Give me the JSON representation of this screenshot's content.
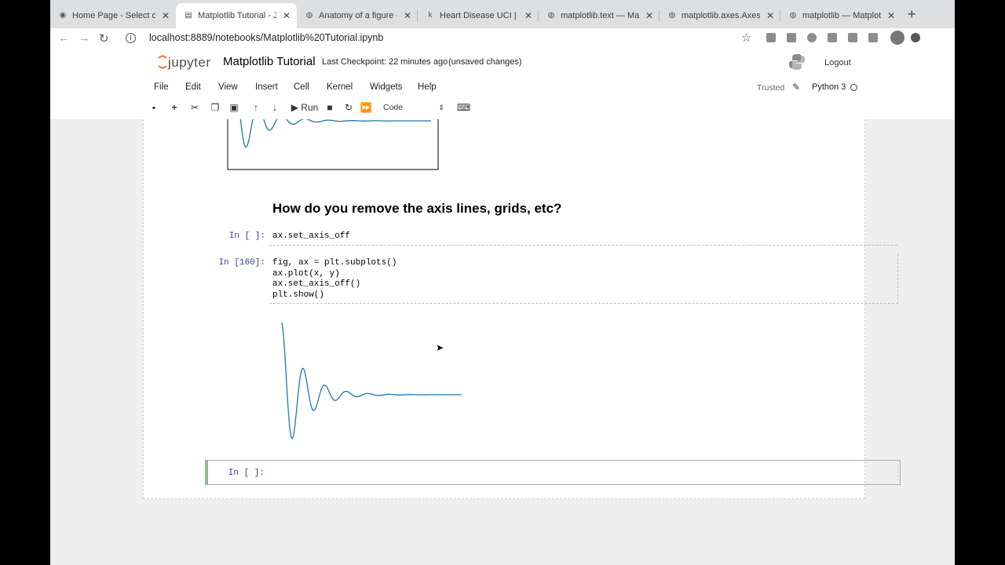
{
  "browser": {
    "tabs": [
      {
        "title": "Home Page - Select o",
        "icon": "jupyter-icon"
      },
      {
        "title": "Matplotlib Tutorial - J",
        "icon": "notebook-icon"
      },
      {
        "title": "Anatomy of a figure —",
        "icon": "matplotlib-icon"
      },
      {
        "title": "Heart Disease UCI | K",
        "icon": "kaggle-icon"
      },
      {
        "title": "matplotlib.text — Ma",
        "icon": "matplotlib-icon"
      },
      {
        "title": "matplotlib.axes.Axes.",
        "icon": "matplotlib-icon"
      },
      {
        "title": "matplotlib — Matplot",
        "icon": "matplotlib-icon"
      }
    ],
    "url": "localhost:8889/notebooks/Matplotlib%20Tutorial.ipynb",
    "new_tab": "+"
  },
  "jupyter": {
    "logo_text": "jupyter",
    "title": "Matplotlib Tutorial",
    "checkpoint": "Last Checkpoint: 22 minutes ago",
    "unsaved": "(unsaved changes)",
    "logout": "Logout",
    "menu": [
      "File",
      "Edit",
      "View",
      "Insert",
      "Cell",
      "Kernel",
      "Widgets",
      "Help"
    ],
    "trusted": "Trusted",
    "kernel": "Python 3",
    "run_label": "Run",
    "cell_type": "Code"
  },
  "notebook": {
    "heading": "How do you remove the axis lines, grids, etc?",
    "cells": [
      {
        "prompt": "In [ ]:",
        "code": [
          "ax.set_axis_off"
        ]
      },
      {
        "prompt": "In [160]:",
        "code": [
          "fig, ax = plt.subplots()",
          "ax.plot(x, y)",
          "ax.set_axis_off()",
          "plt.show()"
        ]
      },
      {
        "prompt": "In [ ]:",
        "code": []
      }
    ]
  },
  "chart_data": [
    {
      "type": "line",
      "title": "",
      "xlabel": "",
      "ylabel": "",
      "axis_visible": true,
      "note": "previous cell output (clipped at top)",
      "function": "damped oscillation"
    },
    {
      "type": "line",
      "title": "",
      "xlabel": "",
      "ylabel": "",
      "axis_visible": false,
      "grid": false,
      "series": [
        {
          "color": "#1f77b4",
          "x": [
            0,
            0.6,
            1.2,
            1.8,
            2.4,
            3.0,
            3.6,
            4.2,
            4.8,
            5.4,
            6.0,
            7.0,
            8.0,
            9.0,
            10.0
          ],
          "y": [
            1.0,
            -0.62,
            0.38,
            -0.23,
            0.14,
            -0.085,
            0.05,
            -0.03,
            0.018,
            -0.011,
            0.006,
            0.002,
            0.0,
            0.0,
            0.0
          ]
        }
      ]
    }
  ]
}
